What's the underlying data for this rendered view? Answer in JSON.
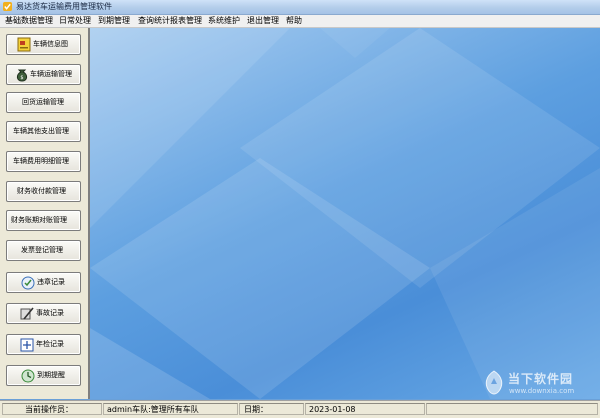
{
  "window": {
    "title": "易达货车运输费用管理软件"
  },
  "menu": [
    "基础数据管理",
    "日常处理",
    "到期管理",
    "查询统计报表管理",
    "系统维护",
    "退出管理",
    "帮助"
  ],
  "nav": [
    {
      "label": "车辆信息图",
      "icon": "vehicle-info-icon"
    },
    {
      "label": "车辆运输管理",
      "icon": "money-bag-icon"
    },
    {
      "label": "回货运输管理",
      "icon": ""
    },
    {
      "label": "车辆其他支出管理",
      "icon": ""
    },
    {
      "label": "车辆费用明细管理",
      "icon": ""
    },
    {
      "label": "财务收付款管理",
      "icon": ""
    },
    {
      "label": "财务账期对账管理",
      "icon": ""
    },
    {
      "label": "发票登记管理",
      "icon": ""
    },
    {
      "label": "违章记录",
      "icon": "violation-icon"
    },
    {
      "label": "事故记录",
      "icon": "accident-icon"
    },
    {
      "label": "年检记录",
      "icon": "inspection-icon"
    },
    {
      "label": "到期提醒",
      "icon": "reminder-icon"
    }
  ],
  "status": {
    "operator_label": "当前操作员：",
    "operator_value": "admin车队:管理所有车队",
    "date_label": "日期：",
    "date_value": "2023-01-08"
  },
  "watermark": {
    "title": "当下软件园",
    "url": "www.downxia.com"
  },
  "colors": {
    "accent": "#4a8ed8",
    "panel": "#ece9d8"
  }
}
